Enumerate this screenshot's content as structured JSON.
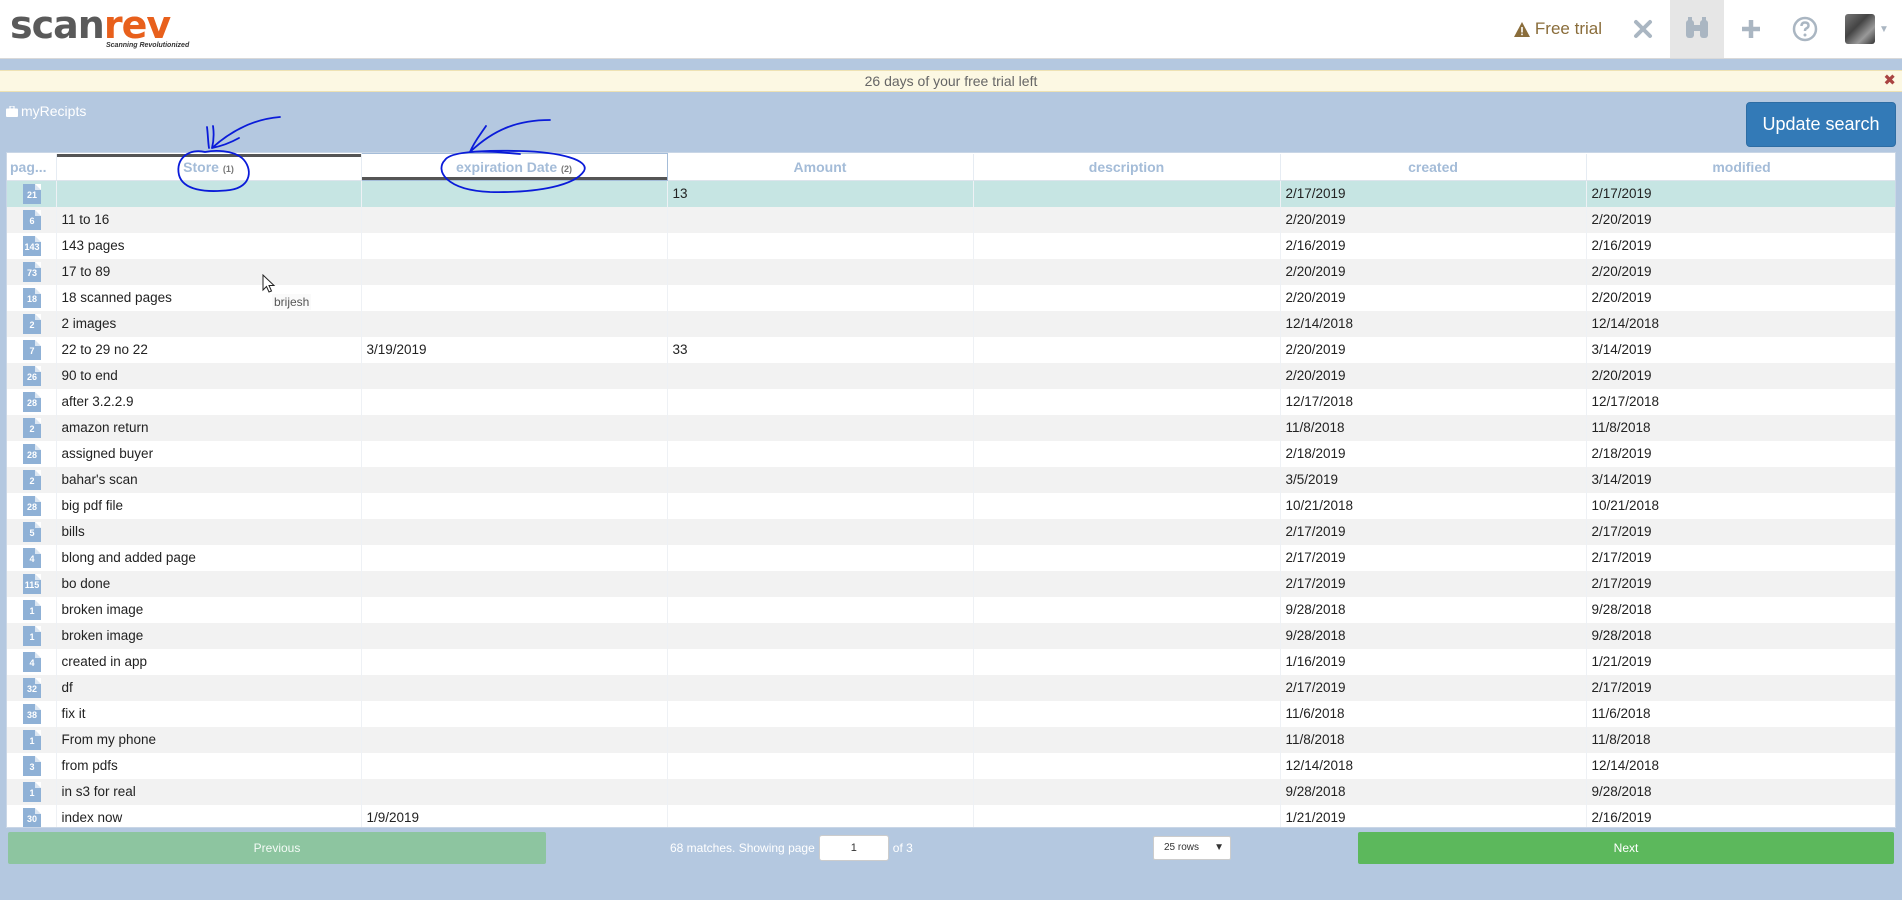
{
  "header": {
    "logo_text_a": "scan",
    "logo_text_b": "rev",
    "logo_tagline": "Scanning Revolutionized",
    "free_trial_label": "Free trial",
    "icons": [
      "warning-icon",
      "close-icon",
      "binoculars-icon",
      "plus-icon",
      "help-icon"
    ],
    "avatar_icon": "user-avatar"
  },
  "banner": {
    "message": "26 days of your free trial left",
    "close_glyph": "✖"
  },
  "breadcrumb": {
    "label": "myRecipts"
  },
  "toolbar": {
    "update_label": "Update search"
  },
  "table": {
    "columns": [
      {
        "label": "pag...",
        "sort": ""
      },
      {
        "label": "Store",
        "sort": "(1)"
      },
      {
        "label": "expiration Date",
        "sort": "(2)"
      },
      {
        "label": "Amount",
        "sort": ""
      },
      {
        "label": "description",
        "sort": ""
      },
      {
        "label": "created",
        "sort": ""
      },
      {
        "label": "modified",
        "sort": ""
      }
    ],
    "rows": [
      {
        "pages": "21",
        "store": "",
        "expiration": "",
        "amount": "13",
        "description": "",
        "created": "2/17/2019",
        "modified": "2/17/2019",
        "selected": true
      },
      {
        "pages": "6",
        "store": "11 to 16",
        "expiration": "",
        "amount": "",
        "description": "",
        "created": "2/20/2019",
        "modified": "2/20/2019"
      },
      {
        "pages": "143",
        "store": "143 pages",
        "expiration": "",
        "amount": "",
        "description": "",
        "created": "2/16/2019",
        "modified": "2/16/2019"
      },
      {
        "pages": "73",
        "store": "17 to 89",
        "expiration": "",
        "amount": "",
        "description": "",
        "created": "2/20/2019",
        "modified": "2/20/2019"
      },
      {
        "pages": "18",
        "store": "18 scanned pages",
        "expiration": "",
        "amount": "",
        "description": "",
        "created": "2/20/2019",
        "modified": "2/20/2019"
      },
      {
        "pages": "2",
        "store": "2 images",
        "expiration": "",
        "amount": "",
        "description": "",
        "created": "12/14/2018",
        "modified": "12/14/2018"
      },
      {
        "pages": "7",
        "store": "22 to 29 no 22",
        "expiration": "3/19/2019",
        "amount": "33",
        "description": "",
        "created": "2/20/2019",
        "modified": "3/14/2019"
      },
      {
        "pages": "26",
        "store": "90 to end",
        "expiration": "",
        "amount": "",
        "description": "",
        "created": "2/20/2019",
        "modified": "2/20/2019"
      },
      {
        "pages": "28",
        "store": "after 3.2.2.9",
        "expiration": "",
        "amount": "",
        "description": "",
        "created": "12/17/2018",
        "modified": "12/17/2018"
      },
      {
        "pages": "2",
        "store": "amazon return",
        "expiration": "",
        "amount": "",
        "description": "",
        "created": "11/8/2018",
        "modified": "11/8/2018"
      },
      {
        "pages": "28",
        "store": "assigned buyer",
        "expiration": "",
        "amount": "",
        "description": "",
        "created": "2/18/2019",
        "modified": "2/18/2019"
      },
      {
        "pages": "2",
        "store": "bahar's scan",
        "expiration": "",
        "amount": "",
        "description": "",
        "created": "3/5/2019",
        "modified": "3/14/2019"
      },
      {
        "pages": "28",
        "store": "big pdf file",
        "expiration": "",
        "amount": "",
        "description": "",
        "created": "10/21/2018",
        "modified": "10/21/2018"
      },
      {
        "pages": "5",
        "store": "bills",
        "expiration": "",
        "amount": "",
        "description": "",
        "created": "2/17/2019",
        "modified": "2/17/2019"
      },
      {
        "pages": "4",
        "store": "blong and added page",
        "expiration": "",
        "amount": "",
        "description": "",
        "created": "2/17/2019",
        "modified": "2/17/2019"
      },
      {
        "pages": "115",
        "store": "bo done",
        "expiration": "",
        "amount": "",
        "description": "",
        "created": "2/17/2019",
        "modified": "2/17/2019"
      },
      {
        "pages": "1",
        "store": "broken image",
        "expiration": "",
        "amount": "",
        "description": "",
        "created": "9/28/2018",
        "modified": "9/28/2018"
      },
      {
        "pages": "1",
        "store": "broken image",
        "expiration": "",
        "amount": "",
        "description": "",
        "created": "9/28/2018",
        "modified": "9/28/2018"
      },
      {
        "pages": "4",
        "store": "created in app",
        "expiration": "",
        "amount": "",
        "description": "",
        "created": "1/16/2019",
        "modified": "1/21/2019"
      },
      {
        "pages": "32",
        "store": "df",
        "expiration": "",
        "amount": "",
        "description": "",
        "created": "2/17/2019",
        "modified": "2/17/2019"
      },
      {
        "pages": "38",
        "store": "fix it",
        "expiration": "",
        "amount": "",
        "description": "",
        "created": "11/6/2018",
        "modified": "11/6/2018"
      },
      {
        "pages": "1",
        "store": "From my phone",
        "expiration": "",
        "amount": "",
        "description": "",
        "created": "11/8/2018",
        "modified": "11/8/2018"
      },
      {
        "pages": "3",
        "store": "from pdfs",
        "expiration": "",
        "amount": "",
        "description": "",
        "created": "12/14/2018",
        "modified": "12/14/2018"
      },
      {
        "pages": "1",
        "store": "in s3 for real",
        "expiration": "",
        "amount": "",
        "description": "",
        "created": "9/28/2018",
        "modified": "9/28/2018"
      },
      {
        "pages": "30",
        "store": "index now",
        "expiration": "1/9/2019",
        "amount": "",
        "description": "",
        "created": "1/21/2019",
        "modified": "2/16/2019"
      }
    ]
  },
  "pager": {
    "previous_label": "Previous",
    "matches_text": "68 matches. Showing page",
    "current_page": "1",
    "of_text": "of 3",
    "rows_option": "25 rows",
    "next_label": "Next"
  },
  "overlay": {
    "tooltip_text": "brijesh",
    "annotation_color": "#0a1bd9"
  }
}
